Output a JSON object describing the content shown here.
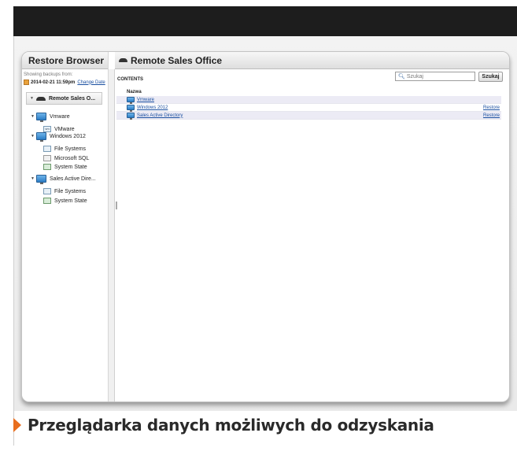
{
  "sidebar": {
    "title": "Restore Browser",
    "backups_label": "Showing backups from:",
    "backup_date": "2014-02-21 11:59pm",
    "change_date": "Change Date",
    "tree": {
      "root": "Remote Sales O...",
      "vmware": {
        "label": "Vmware",
        "children": [
          "VMware"
        ]
      },
      "windows": {
        "label": "Windows 2012",
        "children": [
          "File Systems",
          "Microsoft SQL",
          "System State"
        ]
      },
      "sad": {
        "label": "Sales Active Dire...",
        "children": [
          "File Systems",
          "System State"
        ]
      }
    }
  },
  "main": {
    "title": "Remote Sales Office",
    "contents_label": "CONTENTS",
    "search_placeholder": "Szukaj",
    "search_button": "Szukaj",
    "column_header": "Nazwa",
    "rows": [
      {
        "name": "Vmware",
        "action": ""
      },
      {
        "name": "Windows 2012",
        "action": "Restore"
      },
      {
        "name": "Sales Active Directory",
        "action": "Restore"
      }
    ]
  },
  "caption": "Przeglądarka danych możliwych do odzyskania",
  "colors": {
    "accent": "#e86e1e",
    "link": "#1a4fa0",
    "topbar": "#1d1d1d"
  }
}
